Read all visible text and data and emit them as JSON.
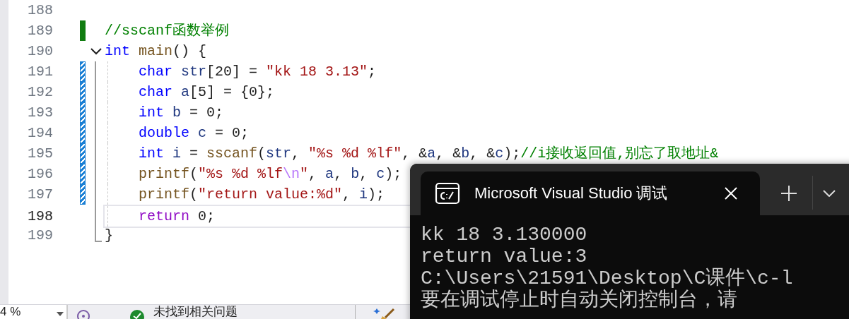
{
  "editor": {
    "lines": [
      {
        "number": "188",
        "current": false,
        "changed": false
      },
      {
        "number": "189",
        "current": false,
        "changed": true,
        "saved": true,
        "tokens": [
          {
            "kind": "comment",
            "text": "//sscanf函数举例"
          }
        ]
      },
      {
        "number": "190",
        "current": false,
        "changed": false,
        "expanded": true,
        "tokens": [
          {
            "kind": "keyword",
            "text": "int"
          },
          {
            "kind": "func",
            "text": " main"
          },
          {
            "kind": "plain",
            "text": "() {"
          }
        ],
        "children": [
          {
            "number": "191",
            "current": false,
            "changed": true,
            "saved": false,
            "tokens": [
              {
                "kind": "keyword",
                "text": "char"
              },
              {
                "kind": "ident",
                "text": " str"
              },
              {
                "kind": "plain",
                "text": "[20] = "
              },
              {
                "kind": "string",
                "text": "\"kk 18 3.13\""
              },
              {
                "kind": "plain",
                "text": ";"
              }
            ]
          },
          {
            "number": "192",
            "current": false,
            "changed": true,
            "saved": false,
            "tokens": [
              {
                "kind": "keyword",
                "text": "char"
              },
              {
                "kind": "ident",
                "text": " a"
              },
              {
                "kind": "plain",
                "text": "[5] = {0};"
              }
            ]
          },
          {
            "number": "193",
            "current": false,
            "changed": true,
            "saved": false,
            "tokens": [
              {
                "kind": "keyword",
                "text": "int"
              },
              {
                "kind": "ident",
                "text": " b"
              },
              {
                "kind": "plain",
                "text": " = 0;"
              }
            ]
          },
          {
            "number": "194",
            "current": false,
            "changed": true,
            "saved": false,
            "tokens": [
              {
                "kind": "keyword",
                "text": "double"
              },
              {
                "kind": "ident",
                "text": " c"
              },
              {
                "kind": "plain",
                "text": " = 0;"
              }
            ]
          },
          {
            "number": "195",
            "current": false,
            "changed": true,
            "saved": false,
            "tokens": [
              {
                "kind": "keyword",
                "text": "int"
              },
              {
                "kind": "ident",
                "text": " i"
              },
              {
                "kind": "plain",
                "text": " = "
              },
              {
                "kind": "func",
                "text": "sscanf"
              },
              {
                "kind": "plain",
                "text": "("
              },
              {
                "kind": "ident",
                "text": "str"
              },
              {
                "kind": "plain",
                "text": ", "
              },
              {
                "kind": "string",
                "text": "\"%s %d %lf\""
              },
              {
                "kind": "plain",
                "text": ", &"
              },
              {
                "kind": "ident",
                "text": "a"
              },
              {
                "kind": "plain",
                "text": ", &"
              },
              {
                "kind": "ident",
                "text": "b"
              },
              {
                "kind": "plain",
                "text": ", &"
              },
              {
                "kind": "ident",
                "text": "c"
              },
              {
                "kind": "plain",
                "text": ");"
              },
              {
                "kind": "comment",
                "text": "//i接收返回值,别忘了取地址&"
              }
            ]
          },
          {
            "number": "196",
            "current": false,
            "changed": true,
            "saved": false,
            "tokens": [
              {
                "kind": "func",
                "text": "printf"
              },
              {
                "kind": "plain",
                "text": "("
              },
              {
                "kind": "string",
                "text": "\"%s %d %lf"
              },
              {
                "kind": "escape",
                "text": "\\n"
              },
              {
                "kind": "string",
                "text": "\""
              },
              {
                "kind": "plain",
                "text": ", "
              },
              {
                "kind": "ident",
                "text": "a"
              },
              {
                "kind": "plain",
                "text": ", "
              },
              {
                "kind": "ident",
                "text": "b"
              },
              {
                "kind": "plain",
                "text": ", "
              },
              {
                "kind": "ident",
                "text": "c"
              },
              {
                "kind": "plain",
                "text": ");"
              }
            ]
          },
          {
            "number": "197",
            "current": false,
            "changed": true,
            "saved": false,
            "tokens": [
              {
                "kind": "func",
                "text": "printf"
              },
              {
                "kind": "plain",
                "text": "("
              },
              {
                "kind": "string",
                "text": "\"return value:%d\""
              },
              {
                "kind": "plain",
                "text": ", "
              },
              {
                "kind": "ident",
                "text": "i"
              },
              {
                "kind": "plain",
                "text": ");"
              }
            ]
          },
          {
            "number": "198",
            "current": true,
            "changed": false,
            "tokens": [
              {
                "kind": "control",
                "text": "return"
              },
              {
                "kind": "plain",
                "text": " 0;"
              }
            ]
          }
        ]
      },
      {
        "number": "199",
        "current": false,
        "changed": false,
        "tokens": [
          {
            "kind": "plain",
            "text": "}"
          }
        ]
      }
    ]
  },
  "status_bar": {
    "zoom": "4 %",
    "issues": "未找到相关问题"
  },
  "console": {
    "tab_title": "Microsoft Visual Studio 调试",
    "output": [
      "kk 18 3.130000",
      "return value:3",
      "C:\\Users\\21591\\Desktop\\C课件\\c-l",
      "要在调试停止时自动关闭控制台，请"
    ]
  }
}
